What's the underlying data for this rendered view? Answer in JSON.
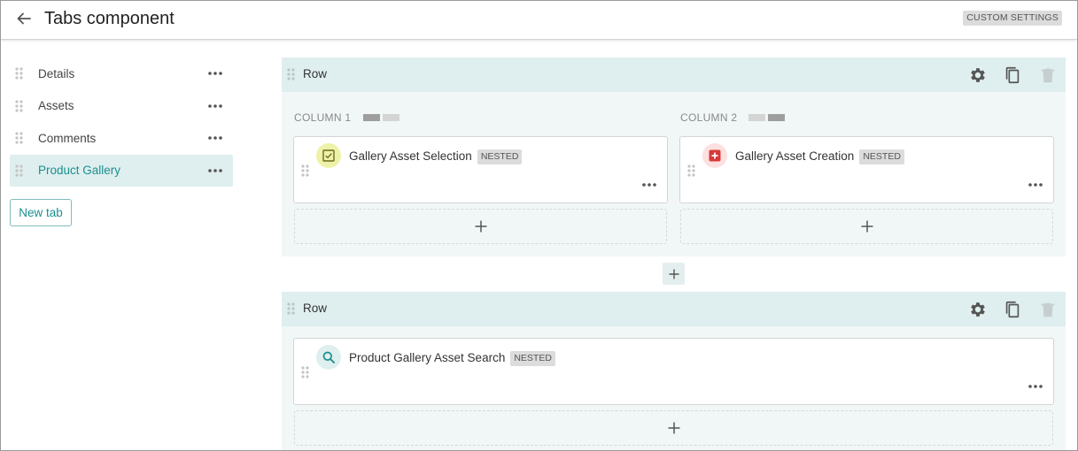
{
  "header": {
    "title": "Tabs component",
    "custom_settings": "CUSTOM SETTINGS"
  },
  "sidebar": {
    "tabs": [
      {
        "label": "Details",
        "active": false
      },
      {
        "label": "Assets",
        "active": false
      },
      {
        "label": "Comments",
        "active": false
      },
      {
        "label": "Product Gallery",
        "active": true
      }
    ],
    "new_tab_label": "New tab"
  },
  "rows": [
    {
      "title": "Row",
      "columns": [
        {
          "label": "COLUMN 1",
          "card": {
            "title": "Gallery Asset Selection",
            "badge": "NESTED",
            "icon": "checkbox-icon"
          }
        },
        {
          "label": "COLUMN 2",
          "card": {
            "title": "Gallery Asset Creation",
            "badge": "NESTED",
            "icon": "plus-box-icon"
          }
        }
      ]
    },
    {
      "title": "Row",
      "columns": [
        {
          "card": {
            "title": "Product Gallery Asset Search",
            "badge": "NESTED",
            "icon": "search-icon"
          }
        }
      ]
    }
  ],
  "colors": {
    "accent": "#1a8f8f",
    "row_header_bg": "#dfeeee",
    "row_body_bg": "#f1f7f7",
    "badge_bg": "#dcdcdc",
    "selection_icon_bg": "#eef2a8",
    "creation_icon_bg": "#fde0e0",
    "creation_icon_fg": "#d63a3a",
    "search_icon_bg": "#dfeeee"
  }
}
